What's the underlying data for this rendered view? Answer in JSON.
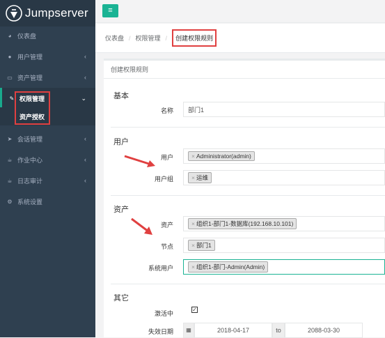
{
  "brand": {
    "name": "Jumpserver",
    "accent": "#1ab394"
  },
  "sidebar": {
    "items": [
      {
        "label": "仪表盘",
        "icon": "dashboard-icon"
      },
      {
        "label": "用户管理",
        "icon": "group-icon"
      },
      {
        "label": "资产管理",
        "icon": "inbox-icon"
      },
      {
        "label": "权限管理",
        "icon": "edit-icon"
      },
      {
        "label": "会话管理",
        "icon": "rocket-icon"
      },
      {
        "label": "作业中心",
        "icon": "coffee-icon"
      },
      {
        "label": "日志审计",
        "icon": "coffee-icon"
      },
      {
        "label": "系统设置",
        "icon": "gears-icon"
      }
    ],
    "sub_item": "资产授权"
  },
  "breadcrumb": {
    "home": "仪表盘",
    "parent": "权限管理",
    "current": "创建权限规则"
  },
  "panel": {
    "title": "创建权限规则"
  },
  "form": {
    "basic": {
      "title": "基本",
      "name_label": "名称",
      "name_value": "部门1"
    },
    "users": {
      "title": "用户",
      "user_label": "用户",
      "user_tag": "Administrator(admin)",
      "group_label": "用户组",
      "group_tag": "运维"
    },
    "assets": {
      "title": "资产",
      "asset_label": "资产",
      "asset_tag": "组织1-部门1-数据库(192.168.10.101)",
      "node_label": "节点",
      "node_tag": "部门1",
      "sysuser_label": "系统用户",
      "sysuser_tag": "组织1-部门-Admin(Admin)"
    },
    "other": {
      "title": "其它",
      "active_label": "激活中",
      "active_checked": true,
      "expire_label": "失效日期",
      "date_start": "2018-04-17",
      "date_to": "to",
      "date_end": "2088-03-30"
    },
    "tag_remove": "×"
  }
}
